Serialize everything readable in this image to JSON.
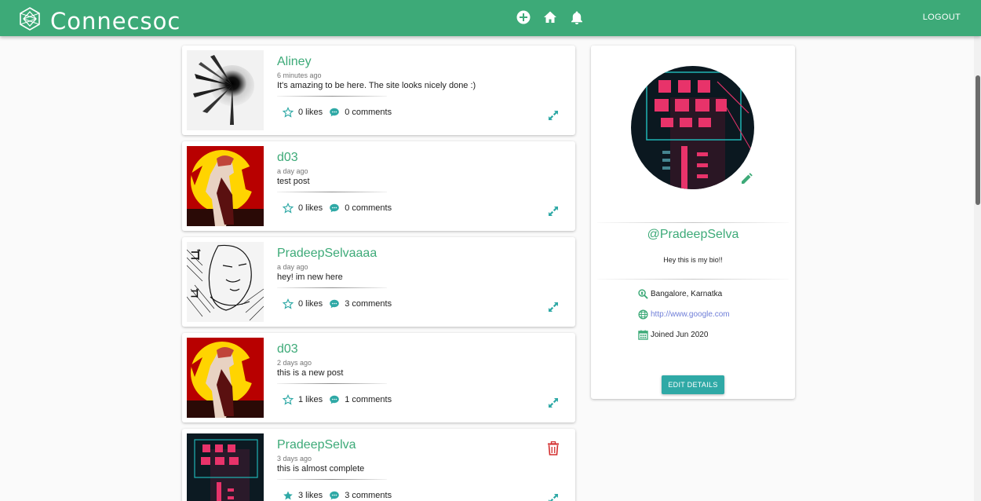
{
  "app": {
    "brand": "Connecsoc",
    "logout_label": "LOGOUT"
  },
  "nav": {
    "icons": [
      "add-circle-icon",
      "home-icon",
      "bell-icon"
    ]
  },
  "colors": {
    "primary": "#3daa78",
    "accent": "#2fa9a6",
    "link": "#6f7ed8",
    "delete": "#d32f2f"
  },
  "posts": [
    {
      "user": "Aliney",
      "time": "6 minutes ago",
      "body": "It's amazing to be here. The site looks nicely done :)",
      "likes": "0 likes",
      "comments": "0 comments",
      "liked": false,
      "can_delete": false,
      "image": "grey-splash"
    },
    {
      "user": "d03",
      "time": "a day ago",
      "body": "test post",
      "likes": "0 likes",
      "comments": "0 comments",
      "liked": false,
      "can_delete": false,
      "image": "red-sun-figure"
    },
    {
      "user": "PradeepSelvaaaa",
      "time": "a day ago",
      "body": "hey! im new here",
      "likes": "0 likes",
      "comments": "3 comments",
      "liked": false,
      "can_delete": false,
      "image": "manga-portrait"
    },
    {
      "user": "d03",
      "time": "2 days ago",
      "body": "this is a new post",
      "likes": "1 likes",
      "comments": "1 comments",
      "liked": false,
      "can_delete": false,
      "image": "red-sun-figure"
    },
    {
      "user": "PradeepSelva",
      "time": "3 days ago",
      "body": "this is almost complete",
      "likes": "3 likes",
      "comments": "3 comments",
      "liked": true,
      "can_delete": true,
      "image": "neon-city"
    }
  ],
  "profile": {
    "handle": "@PradeepSelva",
    "bio": "Hey this is my bio!!",
    "location": "Bangalore, Karnatka",
    "website": "http://www.google.com",
    "joined": "Joined Jun 2020",
    "edit_label": "EDIT DETAILS",
    "avatar": "neon-city"
  }
}
